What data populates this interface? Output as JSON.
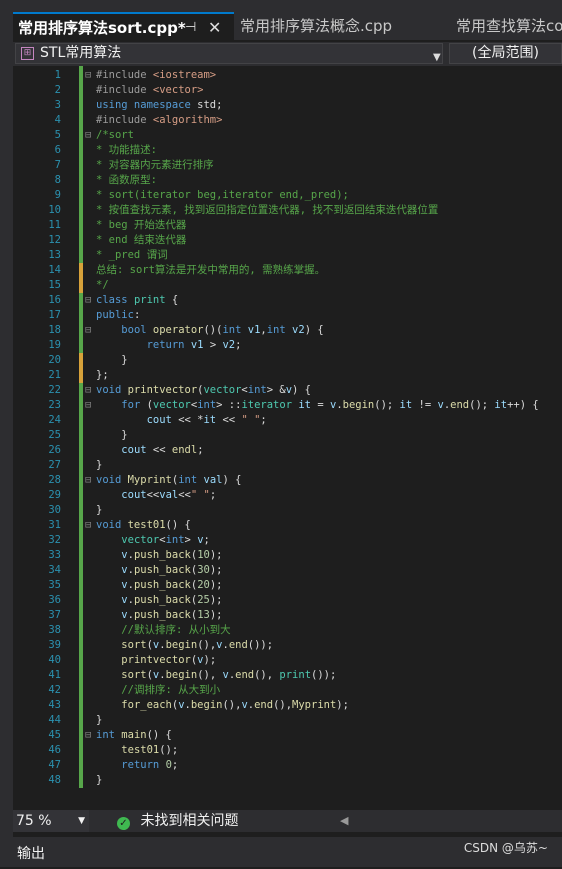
{
  "tabs": [
    {
      "label": "常用排序算法sort.cpp*",
      "active": true
    },
    {
      "label": "常用排序算法概念.cpp"
    },
    {
      "label": "常用查找算法co"
    }
  ],
  "tab_pin": "⊣",
  "tab_close": "✕",
  "navbar": {
    "scope": "STL常用算法",
    "global": "(全局范围)",
    "scope_icon": "class-icon"
  },
  "code_lines": [
    {
      "n": "1",
      "f": "⊟",
      "t": [
        [
          "pp",
          "#include "
        ],
        [
          "inc",
          "<iostream>"
        ]
      ]
    },
    {
      "n": "2",
      "f": "",
      "t": [
        [
          "pp",
          "#include "
        ],
        [
          "inc",
          "<vector>"
        ]
      ]
    },
    {
      "n": "3",
      "f": "",
      "t": [
        [
          "kw",
          "using namespace "
        ],
        [
          "tx",
          "std;"
        ]
      ]
    },
    {
      "n": "4",
      "f": "",
      "t": [
        [
          "pp",
          "#include "
        ],
        [
          "inc",
          "<algorithm>"
        ]
      ]
    },
    {
      "n": "5",
      "f": "⊟",
      "t": [
        [
          "cm",
          "/*sort"
        ]
      ]
    },
    {
      "n": "6",
      "f": "",
      "t": [
        [
          "cm",
          "* 功能描述:"
        ]
      ]
    },
    {
      "n": "7",
      "f": "",
      "t": [
        [
          "cm",
          "* 对容器内元素进行排序"
        ]
      ]
    },
    {
      "n": "8",
      "f": "",
      "t": [
        [
          "cm",
          "* 函数原型:"
        ]
      ]
    },
    {
      "n": "9",
      "f": "",
      "t": [
        [
          "cm",
          "* sort(iterator beg,iterator end,_pred);"
        ]
      ]
    },
    {
      "n": "10",
      "f": "",
      "t": [
        [
          "cm",
          "* 按值查找元素, 找到返回指定位置迭代器, 找不到返回结束迭代器位置"
        ]
      ]
    },
    {
      "n": "11",
      "f": "",
      "t": [
        [
          "cm",
          "* beg 开始迭代器"
        ]
      ]
    },
    {
      "n": "12",
      "f": "",
      "t": [
        [
          "cm",
          "* end 结束迭代器"
        ]
      ]
    },
    {
      "n": "13",
      "f": "",
      "t": [
        [
          "cm",
          "* _pred 谓词"
        ]
      ]
    },
    {
      "n": "14",
      "f": "",
      "t": [
        [
          "cm",
          "总结: sort算法是开发中常用的, 需熟练掌握。"
        ]
      ]
    },
    {
      "n": "15",
      "f": "",
      "t": [
        [
          "cm",
          "*/"
        ]
      ]
    },
    {
      "n": "16",
      "f": "⊟",
      "t": [
        [
          "kw",
          "class "
        ],
        [
          "ty",
          "print "
        ],
        [
          "tx",
          "{"
        ]
      ]
    },
    {
      "n": "17",
      "f": "",
      "t": [
        [
          "kw",
          "public"
        ],
        [
          "tx",
          ":"
        ]
      ]
    },
    {
      "n": "18",
      "f": "⊟",
      "t": [
        [
          "tx",
          "    "
        ],
        [
          "kw",
          "bool "
        ],
        [
          "fn",
          "operator"
        ],
        [
          "tx",
          "()("
        ],
        [
          "kw",
          "int "
        ],
        [
          "vr",
          "v1"
        ],
        [
          "tx",
          ","
        ],
        [
          "kw",
          "int "
        ],
        [
          "vr",
          "v2"
        ],
        [
          "tx",
          ") {"
        ]
      ]
    },
    {
      "n": "19",
      "f": "",
      "t": [
        [
          "tx",
          "        "
        ],
        [
          "kw",
          "return "
        ],
        [
          "vr",
          "v1"
        ],
        [
          "tx",
          " > "
        ],
        [
          "vr",
          "v2"
        ],
        [
          "tx",
          ";"
        ]
      ]
    },
    {
      "n": "20",
      "f": "",
      "t": [
        [
          "tx",
          "    }"
        ]
      ]
    },
    {
      "n": "21",
      "f": "",
      "t": [
        [
          "tx",
          "};"
        ]
      ]
    },
    {
      "n": "22",
      "f": "⊟",
      "t": [
        [
          "kw",
          "void "
        ],
        [
          "fn",
          "printvector"
        ],
        [
          "tx",
          "("
        ],
        [
          "ty",
          "vector"
        ],
        [
          "tx",
          "<"
        ],
        [
          "kw",
          "int"
        ],
        [
          "tx",
          "> &"
        ],
        [
          "vr",
          "v"
        ],
        [
          "tx",
          ") {"
        ]
      ]
    },
    {
      "n": "23",
      "f": "⊟",
      "t": [
        [
          "tx",
          "    "
        ],
        [
          "kw",
          "for "
        ],
        [
          "tx",
          "("
        ],
        [
          "ty",
          "vector"
        ],
        [
          "tx",
          "<"
        ],
        [
          "kw",
          "int"
        ],
        [
          "tx",
          "> ::"
        ],
        [
          "ty",
          "iterator "
        ],
        [
          "vr",
          "it"
        ],
        [
          "tx",
          " = "
        ],
        [
          "vr",
          "v"
        ],
        [
          "tx",
          "."
        ],
        [
          "fn",
          "begin"
        ],
        [
          "tx",
          "(); "
        ],
        [
          "vr",
          "it"
        ],
        [
          "tx",
          " != "
        ],
        [
          "vr",
          "v"
        ],
        [
          "tx",
          "."
        ],
        [
          "fn",
          "end"
        ],
        [
          "tx",
          "(); "
        ],
        [
          "vr",
          "it"
        ],
        [
          "tx",
          "++) {"
        ]
      ]
    },
    {
      "n": "24",
      "f": "",
      "t": [
        [
          "tx",
          "        "
        ],
        [
          "vr",
          "cout"
        ],
        [
          "tx",
          " << *"
        ],
        [
          "vr",
          "it"
        ],
        [
          "tx",
          " << "
        ],
        [
          "st",
          "\" \""
        ],
        [
          "tx",
          ";"
        ]
      ]
    },
    {
      "n": "25",
      "f": "",
      "t": [
        [
          "tx",
          "    }"
        ]
      ]
    },
    {
      "n": "26",
      "f": "",
      "t": [
        [
          "tx",
          "    "
        ],
        [
          "vr",
          "cout"
        ],
        [
          "tx",
          " << "
        ],
        [
          "fn",
          "endl"
        ],
        [
          "tx",
          ";"
        ]
      ]
    },
    {
      "n": "27",
      "f": "",
      "t": [
        [
          "tx",
          "}"
        ]
      ]
    },
    {
      "n": "28",
      "f": "⊟",
      "t": [
        [
          "kw",
          "void "
        ],
        [
          "fn",
          "Myprint"
        ],
        [
          "tx",
          "("
        ],
        [
          "kw",
          "int "
        ],
        [
          "vr",
          "val"
        ],
        [
          "tx",
          ") {"
        ]
      ]
    },
    {
      "n": "29",
      "f": "",
      "t": [
        [
          "tx",
          "    "
        ],
        [
          "vr",
          "cout"
        ],
        [
          "tx",
          "<<"
        ],
        [
          "vr",
          "val"
        ],
        [
          "tx",
          "<<"
        ],
        [
          "st",
          "\" \""
        ],
        [
          "tx",
          ";"
        ]
      ]
    },
    {
      "n": "30",
      "f": "",
      "t": [
        [
          "tx",
          "}"
        ]
      ]
    },
    {
      "n": "31",
      "f": "⊟",
      "t": [
        [
          "kw",
          "void "
        ],
        [
          "fn",
          "test01"
        ],
        [
          "tx",
          "() {"
        ]
      ]
    },
    {
      "n": "32",
      "f": "",
      "t": [
        [
          "tx",
          "    "
        ],
        [
          "ty",
          "vector"
        ],
        [
          "tx",
          "<"
        ],
        [
          "kw",
          "int"
        ],
        [
          "tx",
          "> "
        ],
        [
          "vr",
          "v"
        ],
        [
          "tx",
          ";"
        ]
      ]
    },
    {
      "n": "33",
      "f": "",
      "t": [
        [
          "tx",
          "    "
        ],
        [
          "vr",
          "v"
        ],
        [
          "tx",
          "."
        ],
        [
          "fn",
          "push_back"
        ],
        [
          "tx",
          "("
        ],
        [
          "nm",
          "10"
        ],
        [
          "tx",
          ");"
        ]
      ]
    },
    {
      "n": "34",
      "f": "",
      "t": [
        [
          "tx",
          "    "
        ],
        [
          "vr",
          "v"
        ],
        [
          "tx",
          "."
        ],
        [
          "fn",
          "push_back"
        ],
        [
          "tx",
          "("
        ],
        [
          "nm",
          "30"
        ],
        [
          "tx",
          ");"
        ]
      ]
    },
    {
      "n": "35",
      "f": "",
      "t": [
        [
          "tx",
          "    "
        ],
        [
          "vr",
          "v"
        ],
        [
          "tx",
          "."
        ],
        [
          "fn",
          "push_back"
        ],
        [
          "tx",
          "("
        ],
        [
          "nm",
          "20"
        ],
        [
          "tx",
          ");"
        ]
      ]
    },
    {
      "n": "36",
      "f": "",
      "t": [
        [
          "tx",
          "    "
        ],
        [
          "vr",
          "v"
        ],
        [
          "tx",
          "."
        ],
        [
          "fn",
          "push_back"
        ],
        [
          "tx",
          "("
        ],
        [
          "nm",
          "25"
        ],
        [
          "tx",
          ");"
        ]
      ]
    },
    {
      "n": "37",
      "f": "",
      "t": [
        [
          "tx",
          "    "
        ],
        [
          "vr",
          "v"
        ],
        [
          "tx",
          "."
        ],
        [
          "fn",
          "push_back"
        ],
        [
          "tx",
          "("
        ],
        [
          "nm",
          "13"
        ],
        [
          "tx",
          ");"
        ]
      ]
    },
    {
      "n": "38",
      "f": "",
      "t": [
        [
          "tx",
          "    "
        ],
        [
          "cm",
          "//默认排序: 从小到大"
        ]
      ]
    },
    {
      "n": "39",
      "f": "",
      "t": [
        [
          "tx",
          "    "
        ],
        [
          "fn",
          "sort"
        ],
        [
          "tx",
          "("
        ],
        [
          "vr",
          "v"
        ],
        [
          "tx",
          "."
        ],
        [
          "fn",
          "begin"
        ],
        [
          "tx",
          "(),"
        ],
        [
          "vr",
          "v"
        ],
        [
          "tx",
          "."
        ],
        [
          "fn",
          "end"
        ],
        [
          "tx",
          "());"
        ]
      ]
    },
    {
      "n": "40",
      "f": "",
      "t": [
        [
          "tx",
          "    "
        ],
        [
          "fn",
          "printvector"
        ],
        [
          "tx",
          "("
        ],
        [
          "vr",
          "v"
        ],
        [
          "tx",
          ");"
        ]
      ]
    },
    {
      "n": "41",
      "f": "",
      "t": [
        [
          "tx",
          "    "
        ],
        [
          "fn",
          "sort"
        ],
        [
          "tx",
          "("
        ],
        [
          "vr",
          "v"
        ],
        [
          "tx",
          "."
        ],
        [
          "fn",
          "begin"
        ],
        [
          "tx",
          "(), "
        ],
        [
          "vr",
          "v"
        ],
        [
          "tx",
          "."
        ],
        [
          "fn",
          "end"
        ],
        [
          "tx",
          "(), "
        ],
        [
          "ty",
          "print"
        ],
        [
          "tx",
          "());"
        ]
      ]
    },
    {
      "n": "42",
      "f": "",
      "t": [
        [
          "tx",
          "    "
        ],
        [
          "cm",
          "//调排序: 从大到小"
        ]
      ]
    },
    {
      "n": "43",
      "f": "",
      "t": [
        [
          "tx",
          "    "
        ],
        [
          "fn",
          "for_each"
        ],
        [
          "tx",
          "("
        ],
        [
          "vr",
          "v"
        ],
        [
          "tx",
          "."
        ],
        [
          "fn",
          "begin"
        ],
        [
          "tx",
          "(),"
        ],
        [
          "vr",
          "v"
        ],
        [
          "tx",
          "."
        ],
        [
          "fn",
          "end"
        ],
        [
          "tx",
          "(),"
        ],
        [
          "fn",
          "Myprint"
        ],
        [
          "tx",
          ");"
        ]
      ]
    },
    {
      "n": "44",
      "f": "",
      "t": [
        [
          "tx",
          "}"
        ]
      ]
    },
    {
      "n": "45",
      "f": "⊟",
      "t": [
        [
          "kw",
          "int "
        ],
        [
          "fn",
          "main"
        ],
        [
          "tx",
          "() {"
        ]
      ]
    },
    {
      "n": "46",
      "f": "",
      "t": [
        [
          "tx",
          "    "
        ],
        [
          "fn",
          "test01"
        ],
        [
          "tx",
          "();"
        ]
      ]
    },
    {
      "n": "47",
      "f": "",
      "t": [
        [
          "tx",
          "    "
        ],
        [
          "kw",
          "return "
        ],
        [
          "nm",
          "0"
        ],
        [
          "tx",
          ";"
        ]
      ]
    },
    {
      "n": "48",
      "f": "",
      "t": [
        [
          "tx",
          "}"
        ]
      ]
    }
  ],
  "status": {
    "zoom": "75 %",
    "issues": "未找到相关问题"
  },
  "bottom": {
    "output_label": "输出",
    "watermark": "CSDN @乌苏~"
  },
  "colors": {
    "accent": "#007acc",
    "change_saved": "#57a64a",
    "change_unsaved": "#d7a23a"
  }
}
